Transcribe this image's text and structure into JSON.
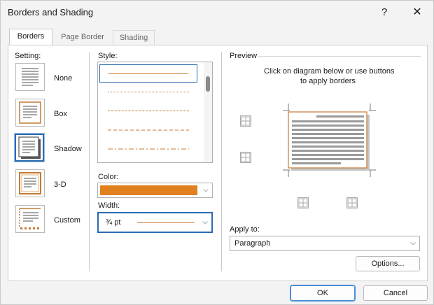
{
  "window": {
    "title": "Borders and Shading",
    "help_label": "?",
    "close_label": "✕"
  },
  "tabs": [
    {
      "label": "Borders",
      "active": true
    },
    {
      "label": "Page Border",
      "active": false
    },
    {
      "label": "Shading",
      "active": false
    }
  ],
  "setting": {
    "heading": "Setting:",
    "options": [
      {
        "label": "None",
        "selected": false
      },
      {
        "label": "Box",
        "selected": false
      },
      {
        "label": "Shadow",
        "selected": true
      },
      {
        "label": "3-D",
        "selected": false
      },
      {
        "label": "Custom",
        "selected": false
      }
    ]
  },
  "style": {
    "heading": "Style:",
    "items": [
      "solid",
      "dotted",
      "dash-small",
      "dash-large",
      "dash-dot"
    ],
    "selected_index": 0
  },
  "color": {
    "heading": "Color:",
    "value": "#e0801e"
  },
  "width": {
    "heading": "Width:",
    "value": "¾ pt"
  },
  "preview": {
    "heading": "Preview",
    "instructions_line1": "Click on diagram below or use buttons",
    "instructions_line2": "to apply borders"
  },
  "apply_to": {
    "heading": "Apply to:",
    "value": "Paragraph"
  },
  "buttons": {
    "options": "Options...",
    "ok": "OK",
    "cancel": "Cancel"
  },
  "colors": {
    "accent": "#e0801e",
    "selection": "#2b6cb0"
  }
}
